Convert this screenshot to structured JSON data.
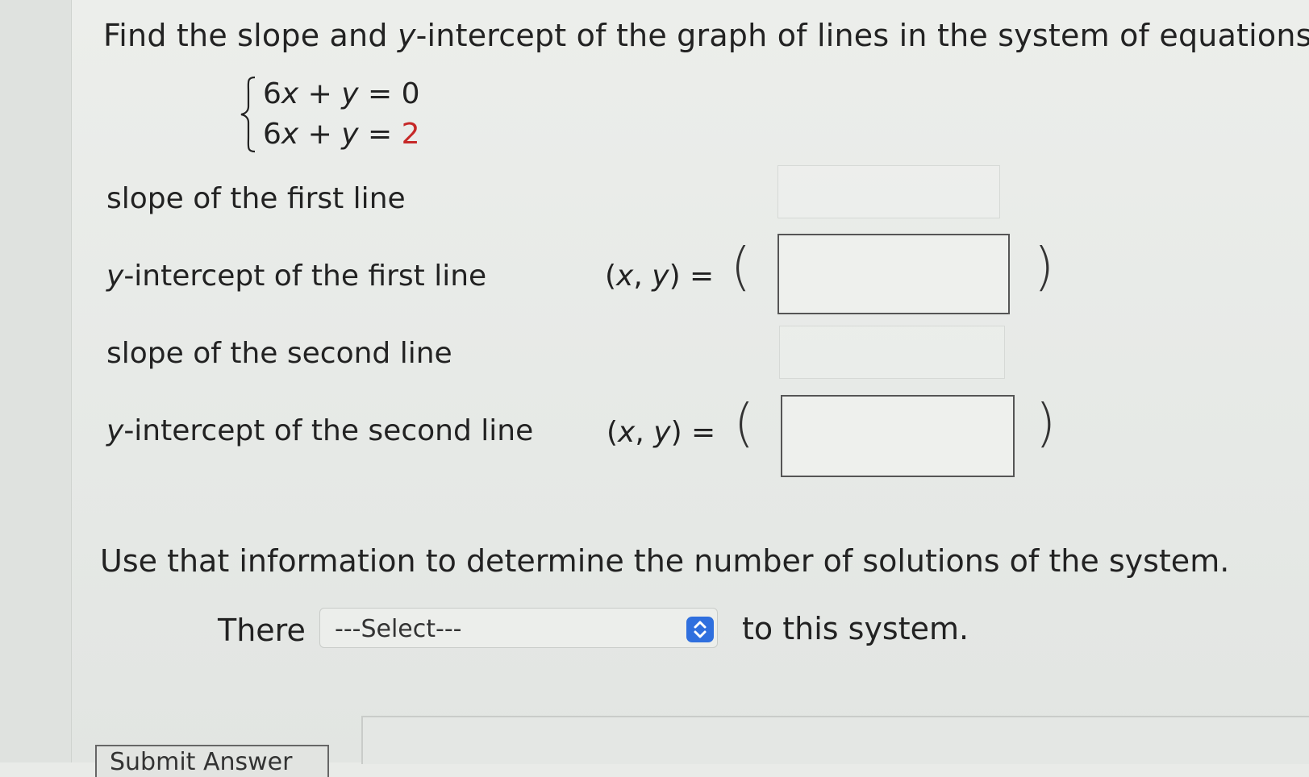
{
  "question": {
    "part1": "Find the slope and ",
    "italic": "y",
    "part2": "-intercept of the graph of lines in the system of equations."
  },
  "system": {
    "eq1": {
      "coef": "6",
      "x": "x",
      "plus": " + ",
      "y": "y",
      "eq": " = ",
      "rhs": "0"
    },
    "eq2": {
      "coef": "6",
      "x": "x",
      "plus": " + ",
      "y": "y",
      "eq": " = ",
      "rhs": "2"
    }
  },
  "fields": {
    "slope1_label": "slope of the first line",
    "yint1_label_italic": "y",
    "yint1_label_rest": "-intercept of the first line",
    "slope2_label": "slope of the second line",
    "yint2_label_italic": "y",
    "yint2_label_rest": "-intercept of the second line",
    "xy_open": "(",
    "xy_x": "x",
    "xy_comma": ", ",
    "xy_y": "y",
    "xy_close": ") =",
    "paren_open": "(",
    "paren_close": ")"
  },
  "instruction": "Use that information to determine the number of solutions of the system.",
  "solution_sentence": {
    "prefix": "There",
    "select_value": "---Select---",
    "suffix": "to this system."
  },
  "submit_button": {
    "label": "Submit Answer"
  },
  "colors": {
    "accent": "#2f6fde",
    "rhs_red": "#c62828"
  }
}
